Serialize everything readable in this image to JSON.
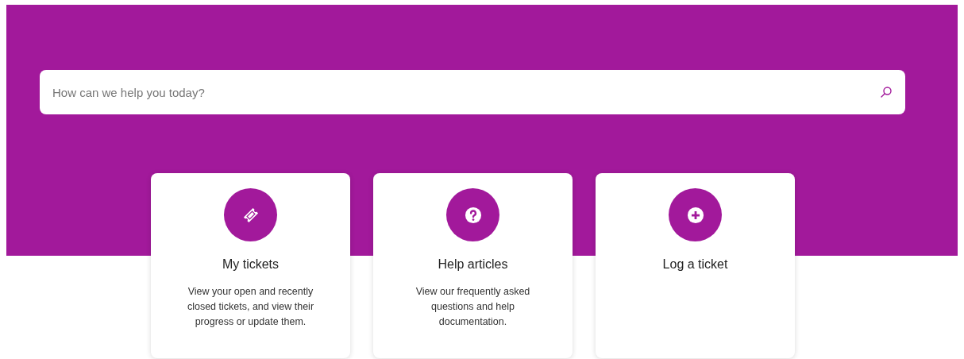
{
  "search": {
    "placeholder": "How can we help you today?"
  },
  "cards": [
    {
      "kind": "ticket",
      "title": "My tickets",
      "description": "View your open and recently closed tickets, and view their progress or update them."
    },
    {
      "kind": "help",
      "title": "Help articles",
      "description": "View our frequently asked questions and help documentation."
    },
    {
      "kind": "add",
      "title": "Log a ticket"
    }
  ]
}
